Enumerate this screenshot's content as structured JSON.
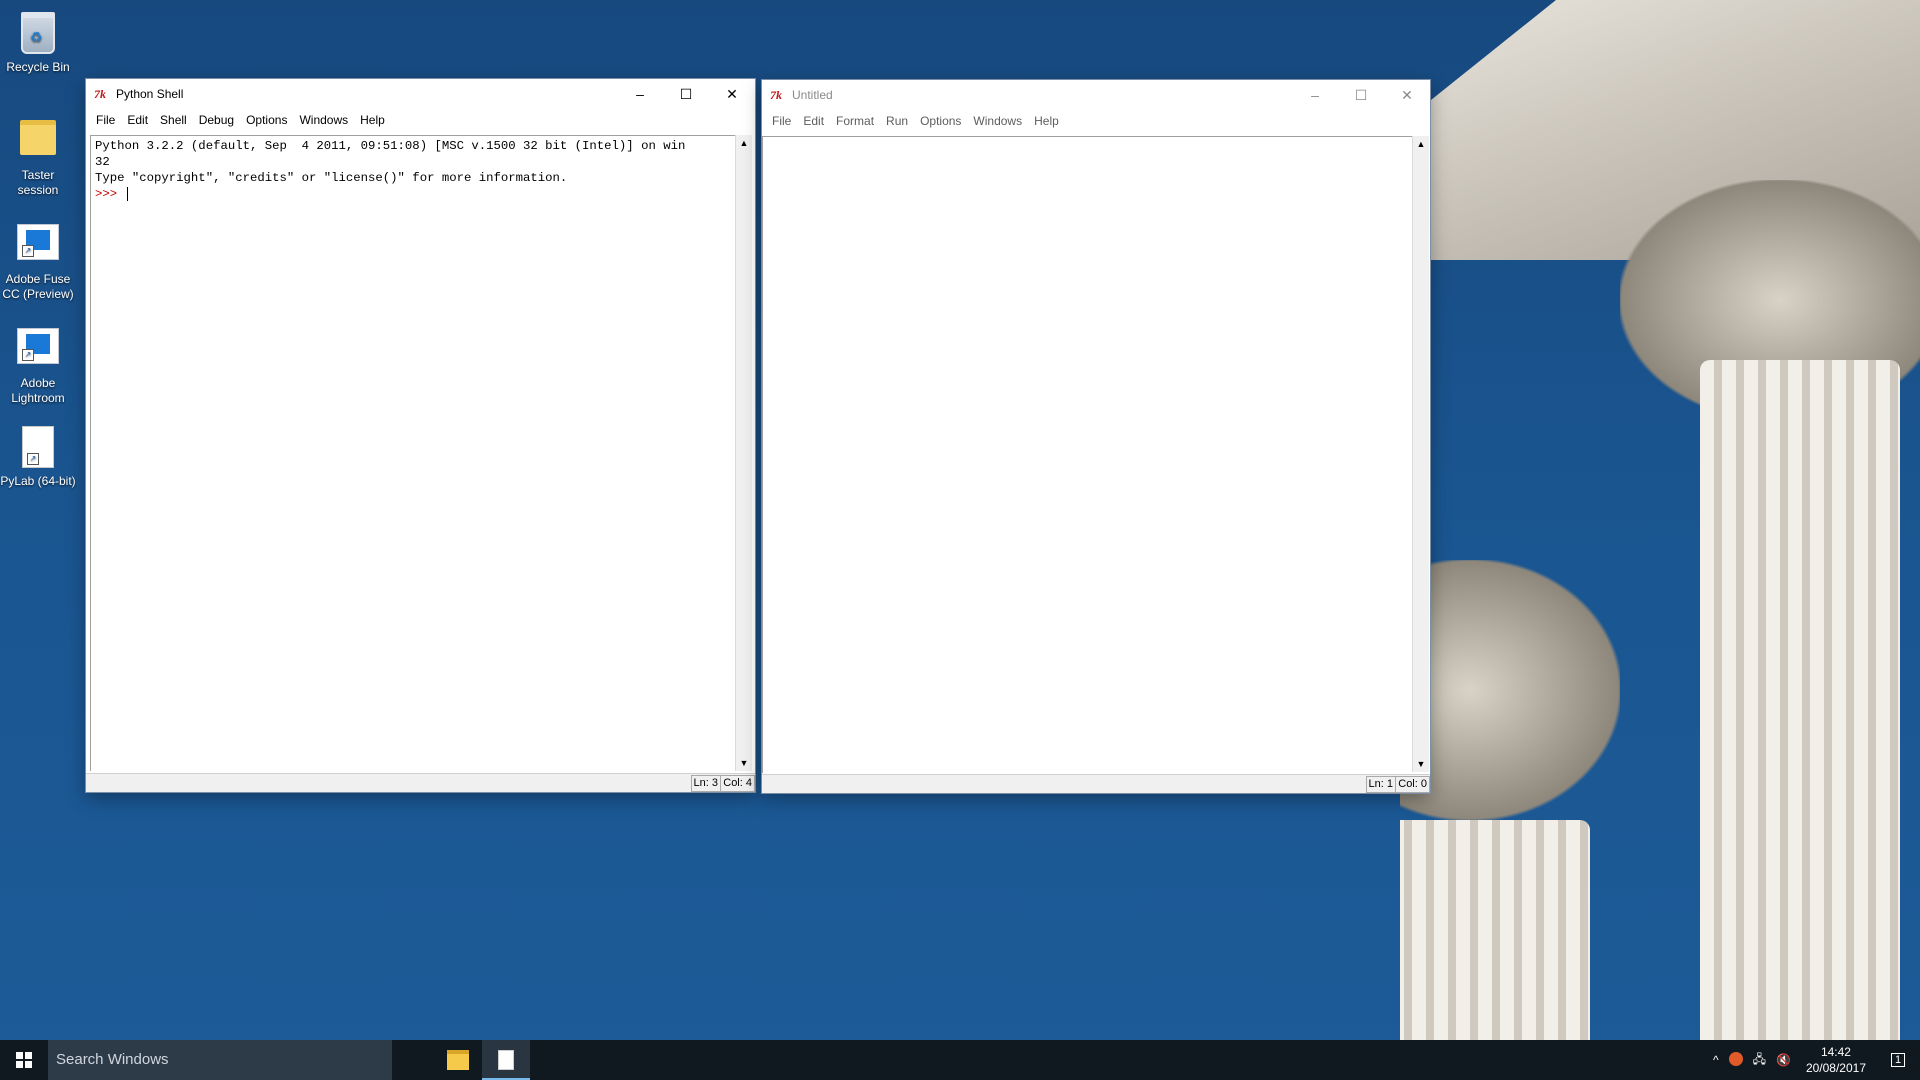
{
  "desktop": {
    "icons": [
      {
        "label": "Recycle Bin",
        "icon": "recycle-bin-icon"
      },
      {
        "label": "Taster session",
        "icon": "folder-icon"
      },
      {
        "label": "Adobe Fuse CC (Preview)",
        "icon": "adobe-fuse-icon"
      },
      {
        "label": "Adobe Lightroom",
        "icon": "adobe-lightroom-icon"
      },
      {
        "label": "PyLab (64-bit)",
        "icon": "pylab-icon"
      }
    ]
  },
  "shell_window": {
    "title": "Python Shell",
    "menu": [
      "File",
      "Edit",
      "Shell",
      "Debug",
      "Options",
      "Windows",
      "Help"
    ],
    "output_line1": "Python 3.2.2 (default, Sep  4 2011, 09:51:08) [MSC v.1500 32 bit (Intel)] on win",
    "output_line2": "32",
    "output_line3": "Type \"copyright\", \"credits\" or \"license()\" for more information.",
    "prompt": ">>> ",
    "status_ln": "Ln: 3",
    "status_col": "Col: 4"
  },
  "editor_window": {
    "title": "Untitled",
    "menu": [
      "File",
      "Edit",
      "Format",
      "Run",
      "Options",
      "Windows",
      "Help"
    ],
    "status_ln": "Ln: 1",
    "status_col": "Col: 0"
  },
  "window_controls": {
    "minimize": "–",
    "maximize": "☐",
    "close": "✕"
  },
  "taskbar": {
    "search_placeholder": "Search Windows",
    "apps": [
      "file-explorer-icon",
      "document-icon"
    ],
    "time": "14:42",
    "date": "20/08/2017",
    "notifications_count": "1"
  },
  "colors": {
    "desktop_blue": "#1a5590",
    "prompt_red": "#c00000",
    "taskbar": "#101820"
  }
}
